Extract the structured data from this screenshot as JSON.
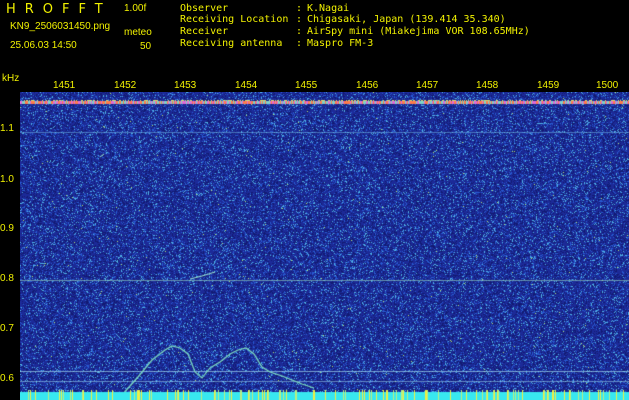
{
  "header": {
    "app_title": "HROFFT",
    "version": "1.00f",
    "filename": "KN9_2506031450.png",
    "timestamp": "25.06.03 14:50",
    "meteo_label": "meteo",
    "meteo_value": "50"
  },
  "info": [
    {
      "label": "Observer",
      "value": "K.Nagai"
    },
    {
      "label": "Receiving Location",
      "value": "Chigasaki, Japan (139.414 35.340)"
    },
    {
      "label": "Receiver",
      "value": "AirSpy mini (Miakejima VOR 108.65MHz)"
    },
    {
      "label": "Receiving antenna",
      "value": "Maspro FM-3"
    }
  ],
  "axis": {
    "unit": "kHz",
    "freq_ticks": [
      "1451",
      "1452",
      "1453",
      "1454",
      "1455",
      "1456",
      "1457",
      "1458",
      "1459",
      "1500"
    ],
    "y_ticks": [
      "1.1",
      "1.0",
      "0.9",
      "0.8",
      "0.7",
      "0.6"
    ]
  },
  "colors": {
    "text": "#f2f200",
    "background": "#000000",
    "noise_floor": "#1c2a98"
  }
}
